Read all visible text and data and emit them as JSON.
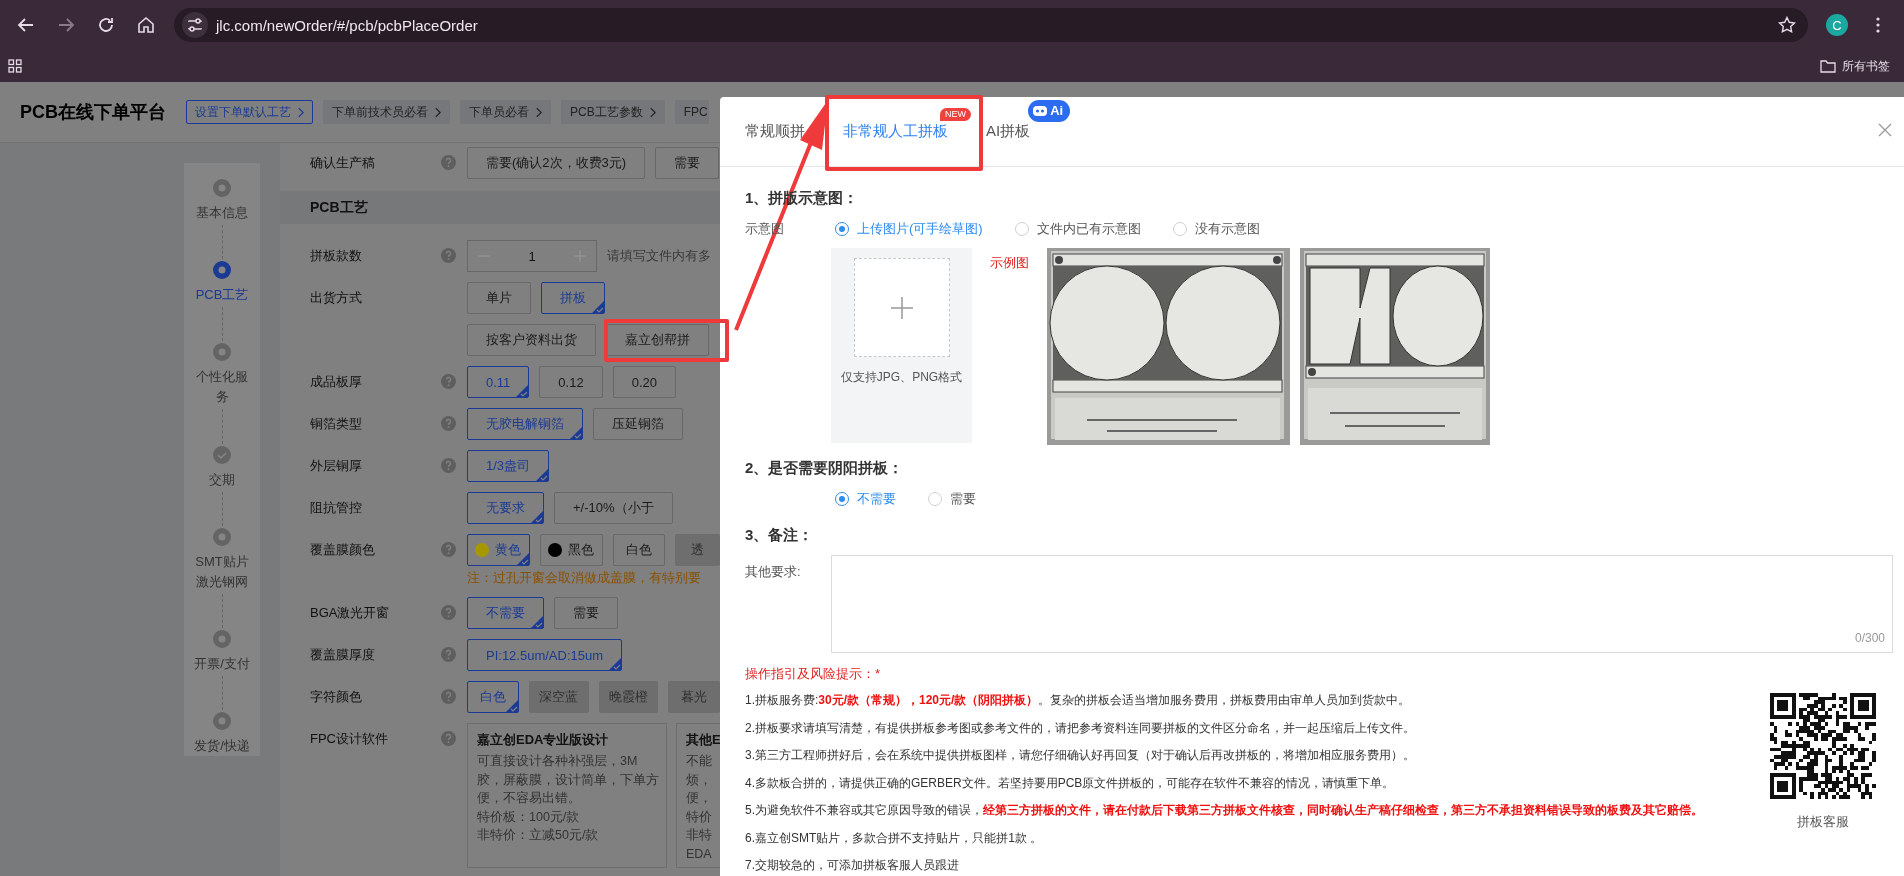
{
  "browser": {
    "url": "jlc.com/newOrder/#/pcb/pcbPlaceOrder",
    "profile_initial": "C",
    "bookmarks_folder": "所有书签"
  },
  "header": {
    "title": "PCB在线下单平台",
    "links": [
      {
        "label": "设置下单默认工艺",
        "kind": "primary"
      },
      {
        "label": "下单前技术员必看",
        "kind": "plain"
      },
      {
        "label": "下单员必看",
        "kind": "plain"
      },
      {
        "label": "PCB工艺参数",
        "kind": "plain"
      },
      {
        "label": "FPC",
        "kind": "cut"
      }
    ]
  },
  "steps": [
    {
      "label": "基本信息",
      "selected": false,
      "done": false
    },
    {
      "label": "PCB工艺",
      "selected": true,
      "done": false
    },
    {
      "label": "个性化服务",
      "selected": false,
      "done": false
    },
    {
      "label": "交期",
      "selected": false,
      "done": true
    },
    {
      "label": "SMT贴片激光钢网",
      "selected": false,
      "done": false
    },
    {
      "label": "开票/支付",
      "selected": false,
      "done": false
    },
    {
      "label": "发货/快递",
      "selected": false,
      "done": false
    }
  ],
  "form": {
    "top_rows": [
      {
        "label": "确认生产稿",
        "help": true,
        "kind": "options",
        "options": [
          {
            "label": "需要(确认2次，收费3元)",
            "selected": false,
            "disabled": false
          },
          {
            "label": "需要",
            "selected": false,
            "disabled": false
          }
        ]
      }
    ],
    "section_title": "PCB工艺",
    "rows": [
      {
        "label": "拼板款数",
        "help": true,
        "kind": "stepper",
        "value": "1",
        "hint": "请填写文件内有多"
      },
      {
        "label": "出货方式",
        "help": false,
        "kind": "options",
        "options": [
          {
            "label": "单片",
            "selected": false,
            "disabled": false
          },
          {
            "label": "拼板",
            "selected": true,
            "disabled": false
          }
        ]
      },
      {
        "help": false,
        "kind": "options",
        "options": [
          {
            "label": "按客户资料出货",
            "selected": false,
            "disabled": false
          },
          {
            "label": "嘉立创帮拼",
            "selected": false,
            "disabled": false
          }
        ]
      },
      {
        "label": "成品板厚",
        "help": true,
        "kind": "options",
        "options": [
          {
            "label": "0.11",
            "selected": true,
            "disabled": false
          },
          {
            "label": "0.12",
            "selected": false,
            "disabled": false
          },
          {
            "label": "0.20",
            "selected": false,
            "disabled": false
          }
        ]
      },
      {
        "label": "铜箔类型",
        "help": true,
        "kind": "options",
        "options": [
          {
            "label": "无胶电解铜箔",
            "selected": true,
            "disabled": false
          },
          {
            "label": "压延铜箔",
            "selected": false,
            "disabled": false
          }
        ]
      },
      {
        "label": "外层铜厚",
        "help": true,
        "kind": "options",
        "options": [
          {
            "label": "1/3盎司",
            "selected": true,
            "disabled": false
          }
        ]
      },
      {
        "label": "阻抗管控",
        "help": false,
        "kind": "options",
        "options": [
          {
            "label": "无要求",
            "selected": true,
            "disabled": false
          },
          {
            "label": "+/-10%（小于",
            "selected": false,
            "disabled": false
          }
        ]
      },
      {
        "label": "覆盖膜颜色",
        "help": true,
        "kind": "options",
        "options": [
          {
            "label": "黄色",
            "selected": true,
            "disabled": false,
            "color": "#a89800"
          },
          {
            "label": "黑色",
            "selected": false,
            "disabled": false,
            "color": "#000000"
          },
          {
            "label": "白色",
            "selected": false,
            "disabled": false
          },
          {
            "label": "透",
            "selected": false,
            "disabled": true
          }
        ],
        "note": "注：过孔开窗会取消做成盖膜，有特别要"
      },
      {
        "label": "BGA激光开窗",
        "help": true,
        "kind": "options",
        "options": [
          {
            "label": "不需要",
            "selected": true,
            "disabled": false
          },
          {
            "label": "需要",
            "selected": false,
            "disabled": false
          }
        ]
      },
      {
        "label": "覆盖膜厚度",
        "help": true,
        "kind": "options",
        "options": [
          {
            "label": "PI:12.5um/AD:15um",
            "selected": true,
            "disabled": false
          }
        ]
      },
      {
        "label": "字符颜色",
        "help": true,
        "kind": "options",
        "options": [
          {
            "label": "白色",
            "selected": true,
            "disabled": false
          },
          {
            "label": "深空蓝",
            "selected": false,
            "disabled": true
          },
          {
            "label": "晚霞橙",
            "selected": false,
            "disabled": true
          },
          {
            "label": "暮光",
            "selected": false,
            "disabled": true
          }
        ]
      },
      {
        "label": "FPC设计软件",
        "help": true,
        "kind": "cards",
        "cards": [
          {
            "title": "嘉立创EDA专业版设计",
            "lines": [
              "可直接设计各种补强层，3M胶，屏蔽膜，设计简单，下单方便，不容易出错。",
              "特价板：100元/款",
              "非特价：立减50元/款"
            ]
          },
          {
            "title": "其他E",
            "lines": [
              "不能",
              "烦，",
              "便，",
              "特价",
              "非特",
              "EDA"
            ]
          }
        ]
      }
    ]
  },
  "modal": {
    "tabs": [
      {
        "label": "常规顺拼",
        "selected": false
      },
      {
        "label": "非常规人工拼板",
        "selected": true,
        "new_badge": "NEW"
      },
      {
        "label": "AI拼板",
        "selected": false,
        "ai_badge": "Ai"
      }
    ],
    "diagram": {
      "title": "1、拼版示意图：",
      "label": "示意图",
      "options": [
        {
          "label": "上传图片(可手绘草图)",
          "selected": true
        },
        {
          "label": "文件内已有示意图",
          "selected": false
        },
        {
          "label": "没有示意图",
          "selected": false
        }
      ],
      "upload_hint": "仅支持JPG、PNG格式",
      "example_label": "示例图",
      "examples": [
        {
          "kind": "picture"
        },
        {
          "kind": "picture"
        }
      ]
    },
    "panel": {
      "title": "2、是否需要阴阳拼板：",
      "options": [
        {
          "label": "不需要",
          "selected": true
        },
        {
          "label": "需要",
          "selected": false
        }
      ]
    },
    "remarks": {
      "title": "3、备注：",
      "label": "其他要求:",
      "counter": "0/300"
    },
    "guide": {
      "title": "操作指引及风险提示：*",
      "lines": [
        "1.拼板服务费:**30元/款（常规），120元/款（阴阳拼板）**。复杂的拼板会适当增加服务费用，拼板费用由审单人员加到货款中。",
        "2.拼板要求请填写清楚，有提供拼板参考图或参考文件的，请把参考资料连同要拼板的文件区分命名，并一起压缩后上传文件。",
        "3.第三方工程师拼好后，会在系统中提供拼板图样，请您仔细确认好再回复（对于确认后再改拼板的，将增加相应服务费用）。",
        "4.多款板合拼的，请提供正确的GERBER文件。若坚持要用PCB原文件拼板的，可能存在软件不兼容的情况，请慎重下单。",
        "5.为避免软件不兼容或其它原因导致的错误，**经第三方拼板的文件，请在付款后下载第三方拼板文件核查，同时确认生产稿仔细检查，第三方不承担资料错误导致的板费及其它赔偿。**",
        "6.嘉立创SMT贴片，多款合拼不支持贴片，只能拼1款 。",
        "7.交期较急的，可添加拼板客服人员跟进"
      ],
      "qr_caption": "拼板客服"
    }
  }
}
